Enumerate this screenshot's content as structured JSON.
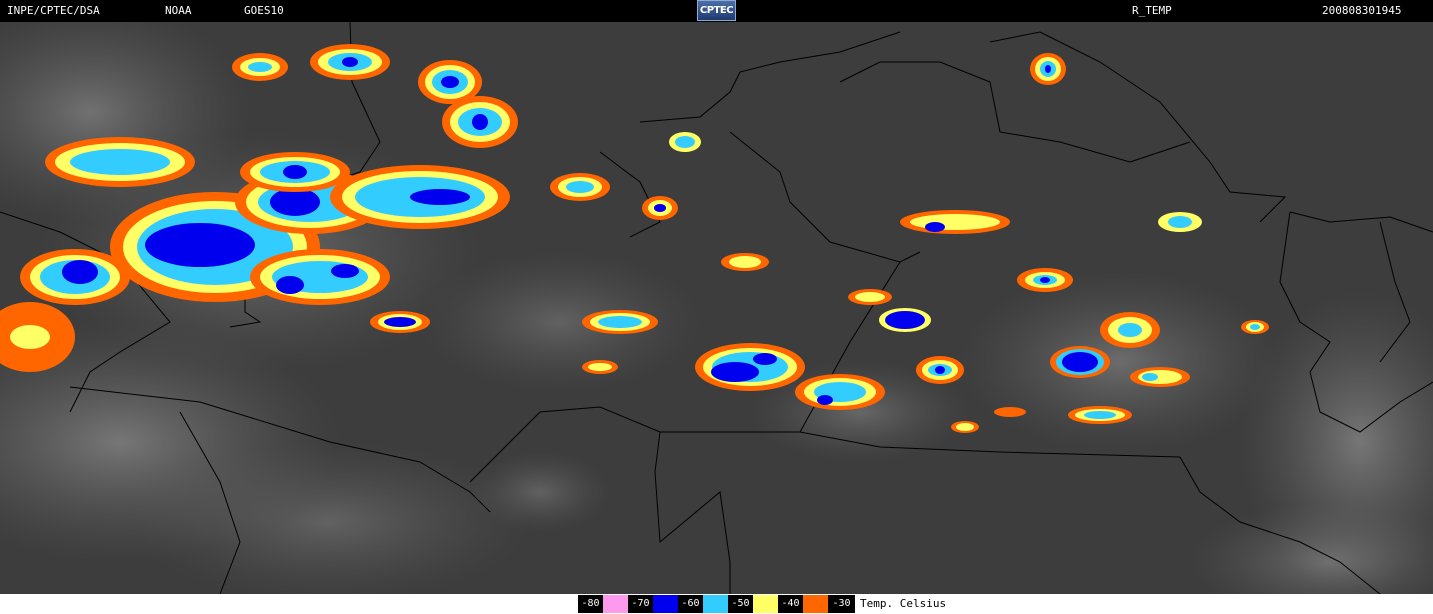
{
  "header": {
    "agency": "INPE/CPTEC/DSA",
    "provider": "NOAA",
    "satellite": "GOES10",
    "logo_text": "CPTEC",
    "product": "R_TEMP",
    "timestamp": "200808301945"
  },
  "legend": {
    "unit_label": "Temp. Celsius",
    "bins": [
      {
        "label": "-80",
        "color": "#ff99ee"
      },
      {
        "label": "-70",
        "color": "#0000ee"
      },
      {
        "label": "-60",
        "color": "#33ccff"
      },
      {
        "label": "-50",
        "color": "#ffff66"
      },
      {
        "label": "-40",
        "color": "#ff6600"
      },
      {
        "label": "-30",
        "color": null
      }
    ]
  },
  "colors": {
    "background_ir": "#3c3c3c",
    "border_lines": "#000000"
  }
}
